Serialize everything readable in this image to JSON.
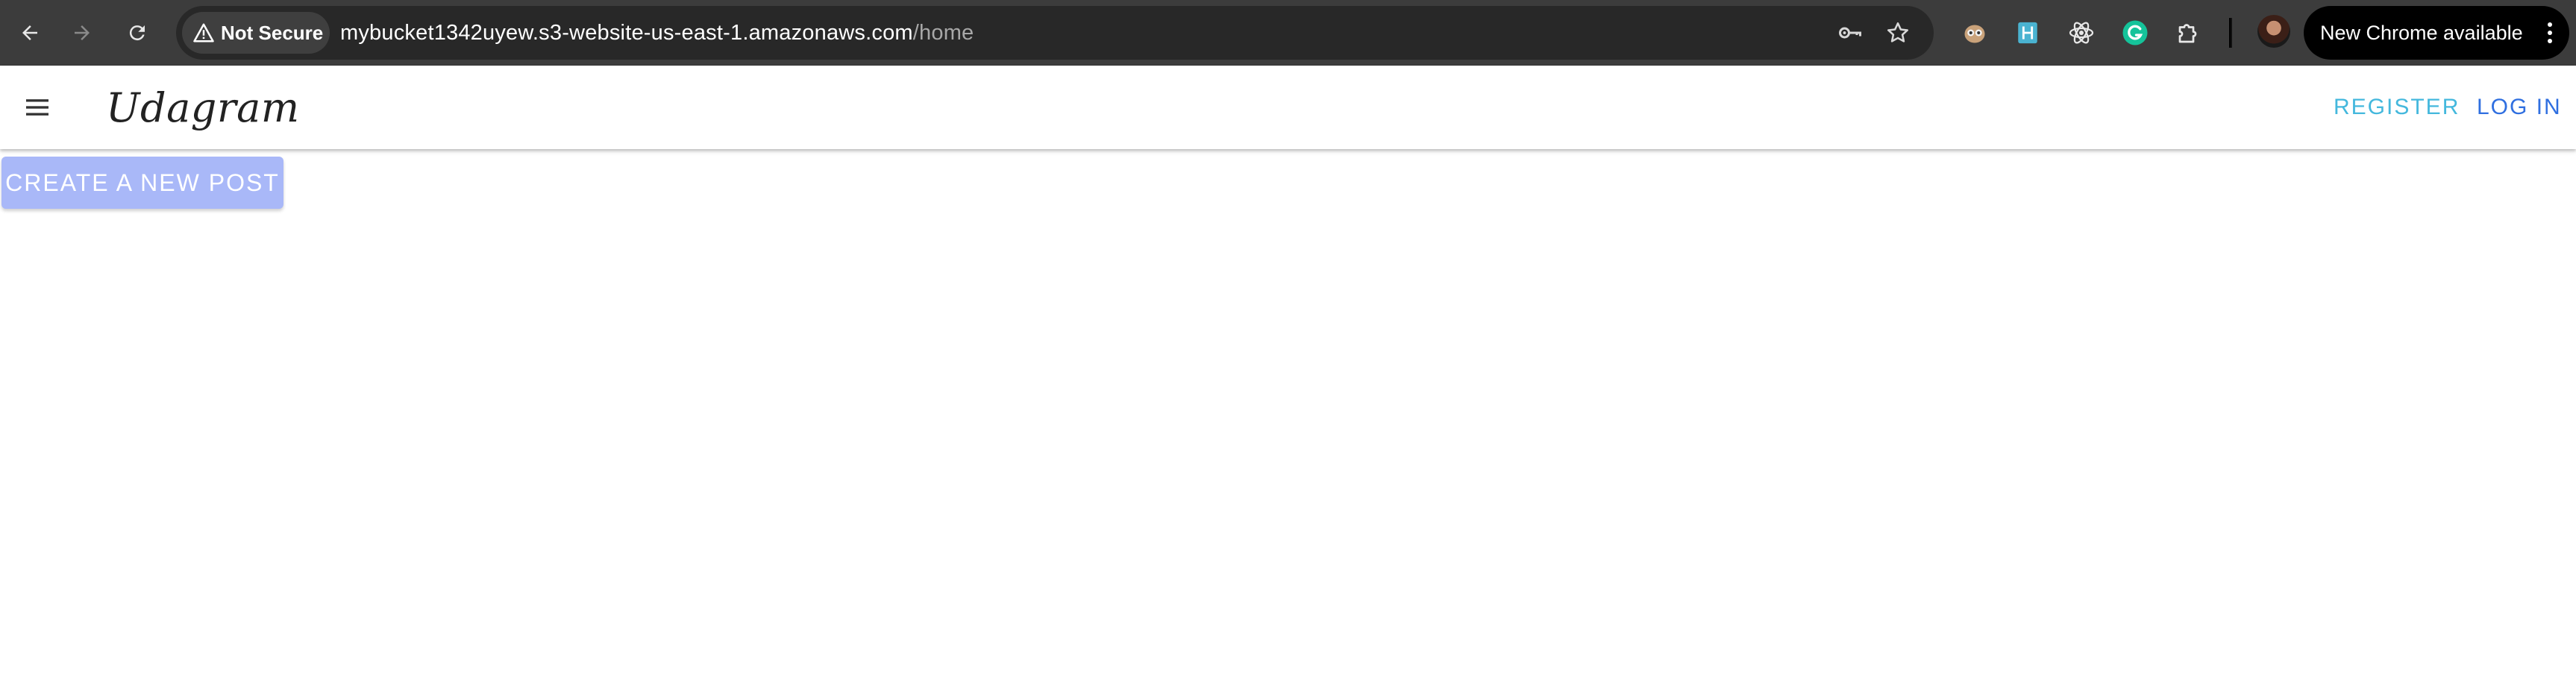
{
  "browser": {
    "security_label": "Not Secure",
    "url_host": "mybucket1342uyew.s3-website-us-east-1.amazonaws.com",
    "url_path": "/home",
    "update_label": "New Chrome available",
    "icons": [
      "back-icon",
      "forward-icon",
      "reload-icon",
      "warning-icon",
      "key-icon",
      "star-icon",
      "owl-extension-icon",
      "h-extension-icon",
      "react-extension-icon",
      "grammarly-extension-icon",
      "puzzle-icon",
      "more-vert-icon"
    ]
  },
  "app": {
    "brand": "Udagram",
    "nav": {
      "register": "REGISTER",
      "login": "LOG IN"
    },
    "create_post_label": "CREATE A NEW POST",
    "colors": {
      "register": "#44b8dd",
      "login": "#2f6fe0",
      "create_button_bg": "#a9b8f8"
    }
  }
}
